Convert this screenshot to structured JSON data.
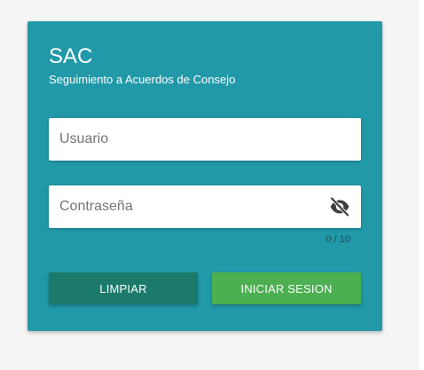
{
  "app": {
    "title": "SAC",
    "subtitle": "Seguimiento a Acuerdos de Consejo"
  },
  "form": {
    "username_placeholder": "Usuario",
    "username_value": "",
    "password_placeholder": "Contraseña",
    "password_value": "",
    "password_counter": "0 / 10",
    "visibility_icon": "eye-off-icon"
  },
  "actions": {
    "clear_label": "LIMPIAR",
    "login_label": "INICIAR SESION"
  },
  "colors": {
    "card_background": "#2199a8",
    "clear_button": "#1c7a6b",
    "login_button": "#4caf50"
  }
}
